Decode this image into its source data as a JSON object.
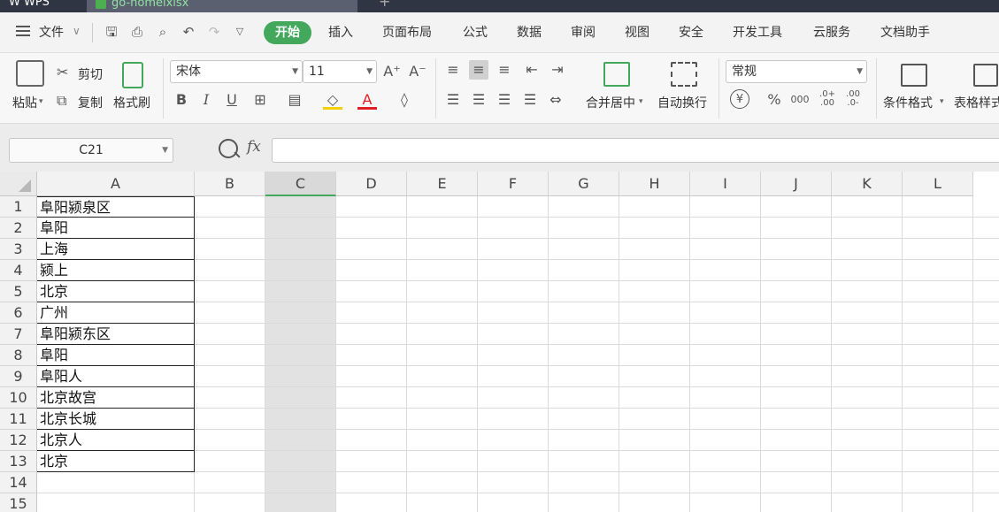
{
  "titlebar": {
    "app_label": "W WPS",
    "doc_name": "go-homelxlsx",
    "plus": "+"
  },
  "menubar": {
    "file_label": "文件",
    "items": [
      "开始",
      "插入",
      "页面布局",
      "公式",
      "数据",
      "审阅",
      "视图",
      "安全",
      "开发工具",
      "云服务",
      "文档助手"
    ],
    "active_index": 0
  },
  "ribbon": {
    "paste": "粘贴",
    "cut": "剪切",
    "copy": "复制",
    "format_painter": "格式刷",
    "font_name": "宋体",
    "font_size": "11",
    "bold": "B",
    "italic": "I",
    "underline": "U",
    "merge_center": "合并居中",
    "wrap_text": "自动换行",
    "number_format": "常规",
    "percent": "%",
    "thousands": "000",
    "inc_decimal": ".0+\n.00",
    "dec_decimal": ".00\n.0-",
    "conditional_format": "条件格式",
    "table_style": "表格样式"
  },
  "formula_bar": {
    "cell_ref": "C21",
    "fx": "fx",
    "formula": ""
  },
  "sheet": {
    "columns": [
      "A",
      "B",
      "C",
      "D",
      "E",
      "F",
      "G",
      "H",
      "I",
      "J",
      "K",
      "L"
    ],
    "selected_column": "C",
    "rows": [
      "1",
      "2",
      "3",
      "4",
      "5",
      "6",
      "7",
      "8",
      "9",
      "10",
      "11",
      "12",
      "13",
      "14",
      "15"
    ],
    "colA": [
      "阜阳颍泉区",
      "阜阳",
      "上海",
      "颍上",
      "北京",
      "广州",
      "阜阳颍东区",
      "阜阳",
      "阜阳人",
      "北京故宫",
      "北京长城",
      "北京人",
      "北京"
    ]
  }
}
